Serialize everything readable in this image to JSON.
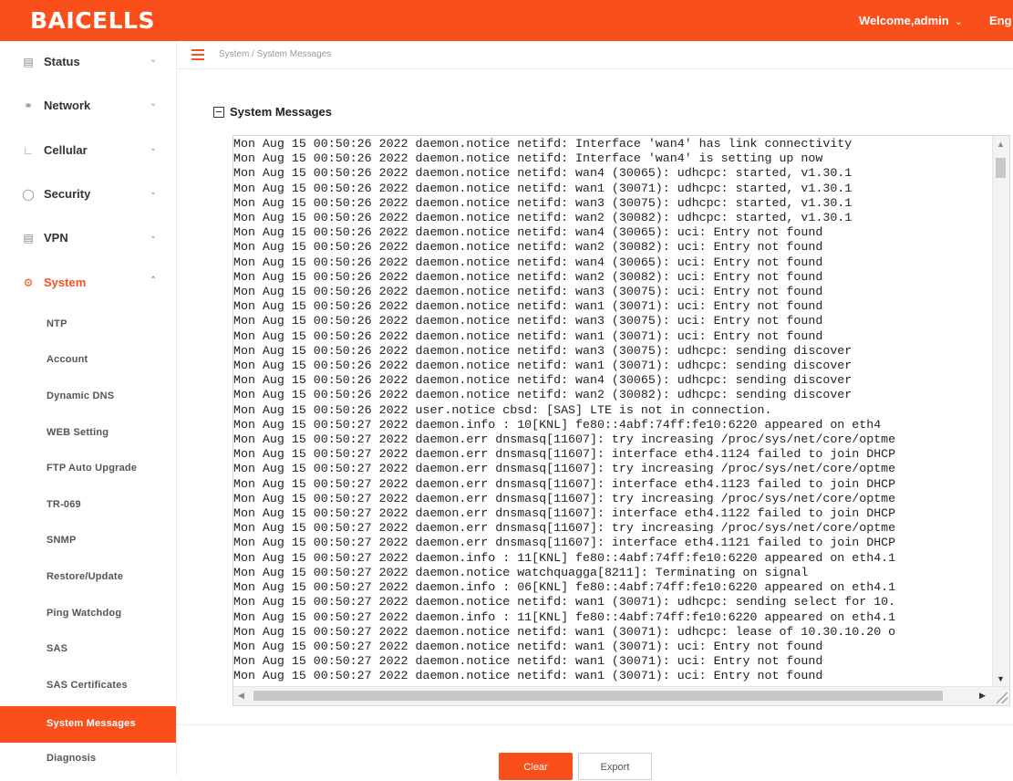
{
  "header": {
    "logo": "BAICELLS",
    "welcome": "Welcome,admin",
    "language": "Eng"
  },
  "sidebar": {
    "menu": [
      {
        "label": "Status",
        "icon": "status-icon"
      },
      {
        "label": "Network",
        "icon": "network-icon"
      },
      {
        "label": "Cellular",
        "icon": "cellular-icon"
      },
      {
        "label": "Security",
        "icon": "security-icon"
      },
      {
        "label": "VPN",
        "icon": "vpn-icon"
      },
      {
        "label": "System",
        "icon": "gear-icon"
      }
    ],
    "system_items": [
      "NTP",
      "Account",
      "Dynamic DNS",
      "WEB Setting",
      "FTP Auto Upgrade",
      "TR-069",
      "SNMP",
      "Restore/Update",
      "Ping Watchdog",
      "SAS",
      "SAS Certificates",
      "System Messages",
      "Diagnosis"
    ],
    "active_item": "System Messages"
  },
  "breadcrumb": "System / System Messages",
  "panel": {
    "title": "System Messages",
    "log_lines": [
      "Mon Aug 15 00:50:26 2022 daemon.notice netifd: Interface 'wan4' has link connectivity",
      "Mon Aug 15 00:50:26 2022 daemon.notice netifd: Interface 'wan4' is setting up now",
      "Mon Aug 15 00:50:26 2022 daemon.notice netifd: wan4 (30065): udhcpc: started, v1.30.1",
      "Mon Aug 15 00:50:26 2022 daemon.notice netifd: wan1 (30071): udhcpc: started, v1.30.1",
      "Mon Aug 15 00:50:26 2022 daemon.notice netifd: wan3 (30075): udhcpc: started, v1.30.1",
      "Mon Aug 15 00:50:26 2022 daemon.notice netifd: wan2 (30082): udhcpc: started, v1.30.1",
      "Mon Aug 15 00:50:26 2022 daemon.notice netifd: wan4 (30065): uci: Entry not found",
      "Mon Aug 15 00:50:26 2022 daemon.notice netifd: wan2 (30082): uci: Entry not found",
      "Mon Aug 15 00:50:26 2022 daemon.notice netifd: wan4 (30065): uci: Entry not found",
      "Mon Aug 15 00:50:26 2022 daemon.notice netifd: wan2 (30082): uci: Entry not found",
      "Mon Aug 15 00:50:26 2022 daemon.notice netifd: wan3 (30075): uci: Entry not found",
      "Mon Aug 15 00:50:26 2022 daemon.notice netifd: wan1 (30071): uci: Entry not found",
      "Mon Aug 15 00:50:26 2022 daemon.notice netifd: wan3 (30075): uci: Entry not found",
      "Mon Aug 15 00:50:26 2022 daemon.notice netifd: wan1 (30071): uci: Entry not found",
      "Mon Aug 15 00:50:26 2022 daemon.notice netifd: wan3 (30075): udhcpc: sending discover",
      "Mon Aug 15 00:50:26 2022 daemon.notice netifd: wan1 (30071): udhcpc: sending discover",
      "Mon Aug 15 00:50:26 2022 daemon.notice netifd: wan4 (30065): udhcpc: sending discover",
      "Mon Aug 15 00:50:26 2022 daemon.notice netifd: wan2 (30082): udhcpc: sending discover",
      "Mon Aug 15 00:50:26 2022 user.notice cbsd: [SAS] LTE is not in connection.",
      "Mon Aug 15 00:50:27 2022 daemon.info : 10[KNL] fe80::4abf:74ff:fe10:6220 appeared on eth4",
      "Mon Aug 15 00:50:27 2022 daemon.err dnsmasq[11607]: try increasing /proc/sys/net/core/optme",
      "Mon Aug 15 00:50:27 2022 daemon.err dnsmasq[11607]: interface eth4.1124 failed to join DHCP",
      "Mon Aug 15 00:50:27 2022 daemon.err dnsmasq[11607]: try increasing /proc/sys/net/core/optme",
      "Mon Aug 15 00:50:27 2022 daemon.err dnsmasq[11607]: interface eth4.1123 failed to join DHCP",
      "Mon Aug 15 00:50:27 2022 daemon.err dnsmasq[11607]: try increasing /proc/sys/net/core/optme",
      "Mon Aug 15 00:50:27 2022 daemon.err dnsmasq[11607]: interface eth4.1122 failed to join DHCP",
      "Mon Aug 15 00:50:27 2022 daemon.err dnsmasq[11607]: try increasing /proc/sys/net/core/optme",
      "Mon Aug 15 00:50:27 2022 daemon.err dnsmasq[11607]: interface eth4.1121 failed to join DHCP",
      "Mon Aug 15 00:50:27 2022 daemon.info : 11[KNL] fe80::4abf:74ff:fe10:6220 appeared on eth4.1",
      "Mon Aug 15 00:50:27 2022 daemon.notice watchquagga[8211]: Terminating on signal",
      "Mon Aug 15 00:50:27 2022 daemon.info : 06[KNL] fe80::4abf:74ff:fe10:6220 appeared on eth4.1",
      "Mon Aug 15 00:50:27 2022 daemon.notice netifd: wan1 (30071): udhcpc: sending select for 10.",
      "Mon Aug 15 00:50:27 2022 daemon.info : 11[KNL] fe80::4abf:74ff:fe10:6220 appeared on eth4.1",
      "Mon Aug 15 00:50:27 2022 daemon.notice netifd: wan1 (30071): udhcpc: lease of 10.30.10.20 o",
      "Mon Aug 15 00:50:27 2022 daemon.notice netifd: wan1 (30071): uci: Entry not found",
      "Mon Aug 15 00:50:27 2022 daemon.notice netifd: wan1 (30071): uci: Entry not found",
      "Mon Aug 15 00:50:27 2022 daemon.notice netifd: wan1 (30071): uci: Entry not found"
    ],
    "clear_label": "Clear",
    "export_label": "Export"
  },
  "colors": {
    "accent": "#fa4e1b"
  }
}
